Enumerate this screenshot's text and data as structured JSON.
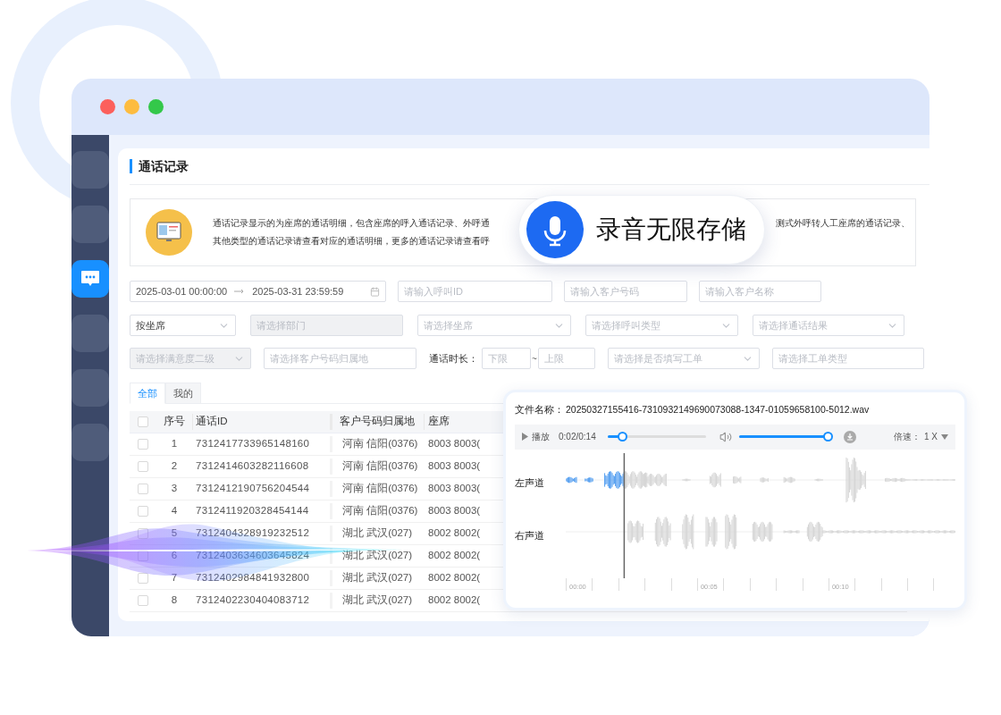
{
  "window": {
    "controls": [
      {
        "color": "#fc605c"
      },
      {
        "color": "#fdbc40"
      },
      {
        "color": "#34c84a"
      }
    ]
  },
  "sidebar": {
    "items": [
      {
        "selected": false
      },
      {
        "selected": false
      },
      {
        "selected": true
      },
      {
        "selected": false
      },
      {
        "selected": false
      },
      {
        "selected": false
      }
    ]
  },
  "page": {
    "title": "通话记录"
  },
  "notice": {
    "lines": [
      {
        "left": "通话记录显示的为座席的通话明细，包含座席的呼入通话记录、外呼通",
        "right": "测式外呼转人工座席的通话记录、"
      },
      {
        "left": "其他类型的通话记录请查看对应的通话明细，更多的通话记录请查看呼"
      }
    ]
  },
  "filters": [
    {
      "fields": [
        {
          "kind": "date_range",
          "start": "2025-03-01 00:00:00",
          "end": "2025-03-31 23:59:59",
          "disabled": false
        },
        {
          "kind": "input",
          "placeholder": "请输入呼叫ID",
          "disabled": false
        },
        {
          "kind": "input",
          "placeholder": "请输入客户号码",
          "disabled": false
        },
        {
          "kind": "input",
          "placeholder": "请输入客户名称",
          "disabled": false
        }
      ]
    },
    {
      "fields": [
        {
          "kind": "select",
          "value": "按坐席",
          "disabled": false
        },
        {
          "kind": "input",
          "placeholder": "请选择部门",
          "disabled": true
        },
        {
          "kind": "select",
          "placeholder": "请选择坐席",
          "disabled": false
        },
        {
          "kind": "select",
          "placeholder": "请选择呼叫类型",
          "disabled": false
        },
        {
          "kind": "select",
          "placeholder": "请选择通话结果",
          "disabled": false
        }
      ]
    },
    {
      "fields": [
        {
          "kind": "select",
          "placeholder": "请选择满意度二级",
          "disabled": true
        },
        {
          "kind": "input",
          "placeholder": "请选择客户号码归属地",
          "disabled": false
        },
        {
          "kind": "range",
          "label": "通话时长：",
          "min_placeholder": "下限",
          "separator": "~",
          "max_placeholder": "上限",
          "disabled": false
        },
        {
          "kind": "select",
          "placeholder": "请选择是否填写工单",
          "disabled": false
        },
        {
          "kind": "input",
          "placeholder": "请选择工单类型",
          "disabled": false
        }
      ]
    }
  ],
  "tabs": [
    {
      "label": "全部",
      "selected": true
    },
    {
      "label": "我的",
      "selected": false
    }
  ],
  "table": {
    "all_checked": false,
    "columns": [
      "序号",
      "通话ID",
      "客户号码归属地",
      "座席"
    ],
    "rows": [
      {
        "checked": false,
        "cells": [
          "1",
          "7312417733965148160",
          "河南 信阳(0376)",
          "8003 8003("
        ]
      },
      {
        "checked": false,
        "cells": [
          "2",
          "7312414603282116608",
          "河南 信阳(0376)",
          "8003 8003("
        ]
      },
      {
        "checked": false,
        "cells": [
          "3",
          "7312412190756204544",
          "河南 信阳(0376)",
          "8003 8003("
        ]
      },
      {
        "checked": false,
        "cells": [
          "4",
          "7312411920328454144",
          "河南 信阳(0376)",
          "8003 8003("
        ]
      },
      {
        "checked": false,
        "cells": [
          "5",
          "7312404328919232512",
          "湖北 武汉(027)",
          "8002 8002("
        ]
      },
      {
        "checked": false,
        "cells": [
          "6",
          "7312403634603645824",
          "湖北 武汉(027)",
          "8002 8002("
        ]
      },
      {
        "checked": false,
        "cells": [
          "7",
          "7312402984841932800",
          "湖北 武汉(027)",
          "8002 8002("
        ]
      },
      {
        "checked": false,
        "cells": [
          "8",
          "7312402230404083712",
          "湖北 武汉(027)",
          "8002 8002("
        ]
      }
    ]
  },
  "banner": {
    "text": "录音无限存储"
  },
  "audio": {
    "file_label": "文件名称：",
    "file_name": "20250327155416-7310932149690073088-1347-01059658100-5012.wav",
    "play_label": "播放",
    "time": "0:02/0:14",
    "progress": {
      "level": 0.15
    },
    "volume": {
      "level": 1
    },
    "speed_label": "倍速：",
    "speed": "1 X",
    "channels": [
      {
        "label": "左声道"
      },
      {
        "label": "右声道"
      }
    ],
    "timeline": [
      {
        "label": "00:00"
      },
      {
        "label": "00:05"
      },
      {
        "label": "00:10"
      }
    ]
  }
}
